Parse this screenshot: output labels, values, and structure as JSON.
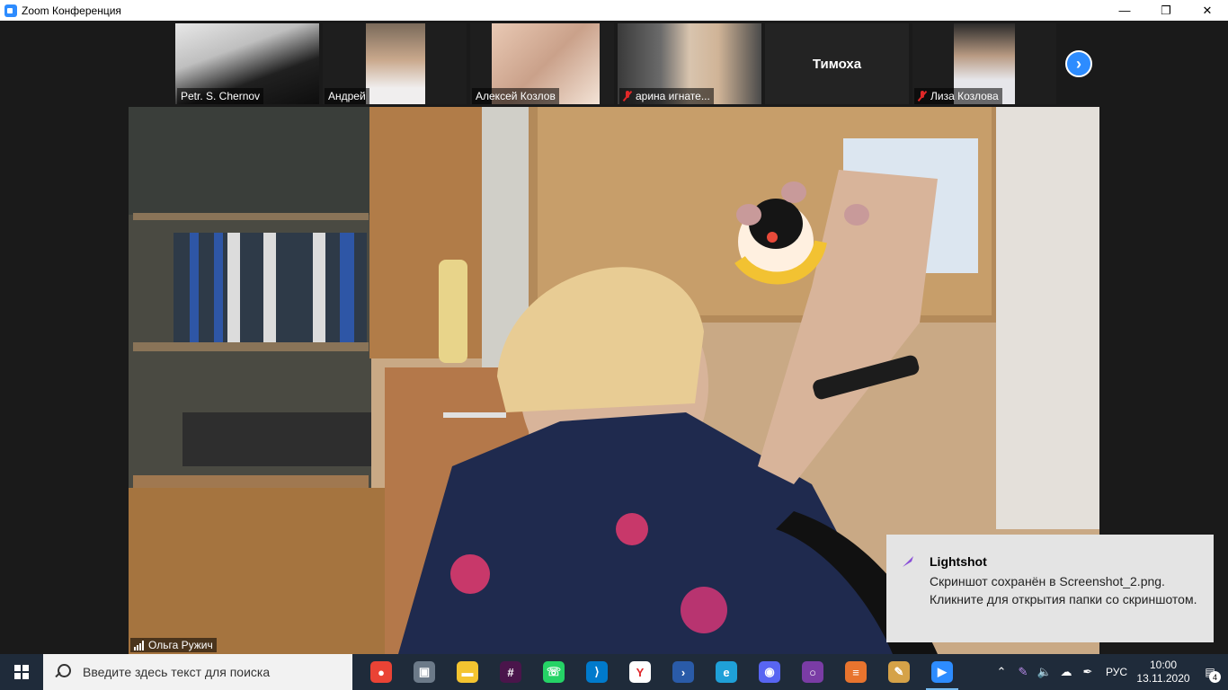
{
  "window": {
    "title": "Zoom Конференция",
    "controls": {
      "minimize": "—",
      "maximize": "❐",
      "close": "✕"
    }
  },
  "gallery": {
    "participants": [
      {
        "name": "Petr. S. Chernov",
        "muted": false
      },
      {
        "name": "Андрей",
        "muted": false
      },
      {
        "name": "Алексей Козлов",
        "muted": false
      },
      {
        "name": "арина игнате...",
        "muted": true
      },
      {
        "name": "Тимоха",
        "muted": false,
        "video_off": true
      },
      {
        "name": "Лиза Козлова",
        "muted": true
      }
    ],
    "next_page_icon": "chevron-right-icon"
  },
  "speaker": {
    "name": "Ольга Ружич"
  },
  "toast": {
    "app": "Lightshot",
    "line1": "Скриншот сохранён в Screenshot_2.png.",
    "line2": "Кликните для открытия папки со скриншотом.",
    "accent": "#8a4fd8"
  },
  "taskbar": {
    "search_placeholder": "Введите здесь текст для поиска",
    "apps": [
      {
        "name": "chrome",
        "icon": "chrome-icon",
        "color": "#ea4335",
        "glyph": "●"
      },
      {
        "name": "virtualbox",
        "icon": "cube-icon",
        "color": "#6c7a89",
        "glyph": "▣"
      },
      {
        "name": "explorer",
        "icon": "folder-icon",
        "color": "#f4c430",
        "glyph": "▬"
      },
      {
        "name": "slack",
        "icon": "slack-icon",
        "color": "#4a154b",
        "glyph": "#"
      },
      {
        "name": "whatsapp",
        "icon": "whatsapp-icon",
        "color": "#25d366",
        "glyph": "☏"
      },
      {
        "name": "vscode",
        "icon": "vscode-icon",
        "color": "#007acc",
        "glyph": "⟩"
      },
      {
        "name": "yandex",
        "icon": "yandex-icon",
        "color": "#ffffff",
        "glyph": "Y"
      },
      {
        "name": "powershell",
        "icon": "terminal-icon",
        "color": "#2a5ba8",
        "glyph": "›"
      },
      {
        "name": "edge",
        "icon": "edge-icon",
        "color": "#1fa0d8",
        "glyph": "e"
      },
      {
        "name": "discord",
        "icon": "discord-icon",
        "color": "#5865f2",
        "glyph": "◉"
      },
      {
        "name": "obs",
        "icon": "record-icon",
        "color": "#7a3ca5",
        "glyph": "○"
      },
      {
        "name": "notes",
        "icon": "document-icon",
        "color": "#e8742e",
        "glyph": "≡"
      },
      {
        "name": "paint",
        "icon": "palette-icon",
        "color": "#d5a248",
        "glyph": "✎"
      },
      {
        "name": "zoom",
        "icon": "zoom-icon",
        "color": "#2d8cff",
        "glyph": "▶",
        "active": true
      }
    ],
    "tray": {
      "language": "РУС",
      "time": "10:00",
      "date": "13.11.2020",
      "notifications": "4"
    }
  }
}
